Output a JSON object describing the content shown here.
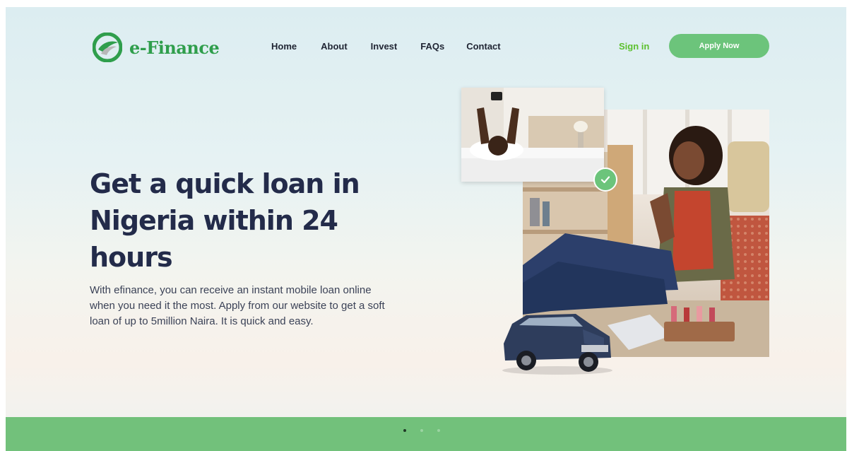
{
  "brand": {
    "name": "e-Finance",
    "color": "#2f9e4c"
  },
  "nav": {
    "items": [
      {
        "label": "Home"
      },
      {
        "label": "About"
      },
      {
        "label": "Invest"
      },
      {
        "label": "FAQs"
      },
      {
        "label": "Contact"
      }
    ],
    "signin_label": "Sign in",
    "apply_label": "Apply Now"
  },
  "hero": {
    "title": "Get a quick loan in Nigeria within 24 hours",
    "description": "With efinance, you can receive an instant mobile loan online when you need it the most. Apply from our website to get a soft loan of up to 5million Naira. It is quick and easy."
  },
  "carousel": {
    "slide_count": 3,
    "active_index": 0
  },
  "colors": {
    "accent": "#6cc47b",
    "signin": "#5cc02e",
    "heading": "#232b4a",
    "bottom_bar": "#72c17b"
  },
  "icons": {
    "logo": "efinance-logo-icon",
    "check": "check-icon"
  }
}
